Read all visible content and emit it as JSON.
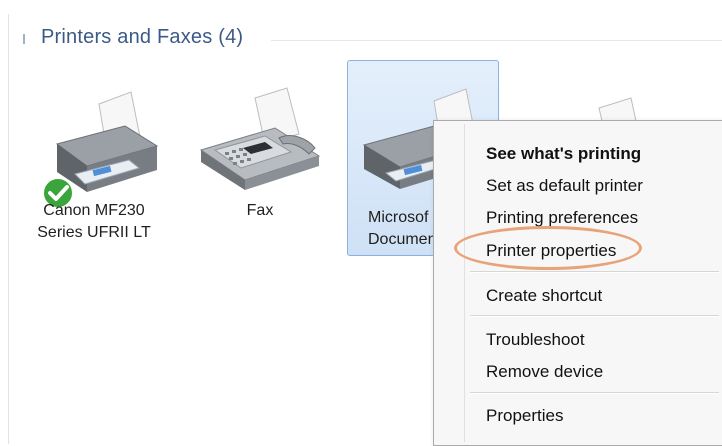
{
  "group": {
    "title": "Printers and Faxes (4)"
  },
  "devices": [
    {
      "line1": "Canon MF230",
      "line2": "Series UFRII LT",
      "default_printer": true
    },
    {
      "line1": "Fax",
      "line2": ""
    },
    {
      "line1": "Microsof",
      "line2": "Document",
      "selected": true
    },
    {
      "line1": "",
      "line2": ""
    }
  ],
  "context_menu": {
    "items": [
      {
        "label": "See what's printing",
        "bold": true
      },
      {
        "label": "Set as default printer"
      },
      {
        "label": "Printing preferences"
      },
      {
        "label": "Printer properties",
        "highlighted": true
      },
      {
        "label": "Create shortcut"
      },
      {
        "label": "Troubleshoot"
      },
      {
        "label": "Remove device"
      },
      {
        "label": "Properties"
      }
    ]
  },
  "colors": {
    "group_title": "#3b5a86",
    "selection": "#cfe1f6",
    "highlight_ring": "#e8a478",
    "default_check": "#3aa53a"
  },
  "icons": [
    "printer-icon",
    "fax-icon",
    "checkmark-icon"
  ]
}
